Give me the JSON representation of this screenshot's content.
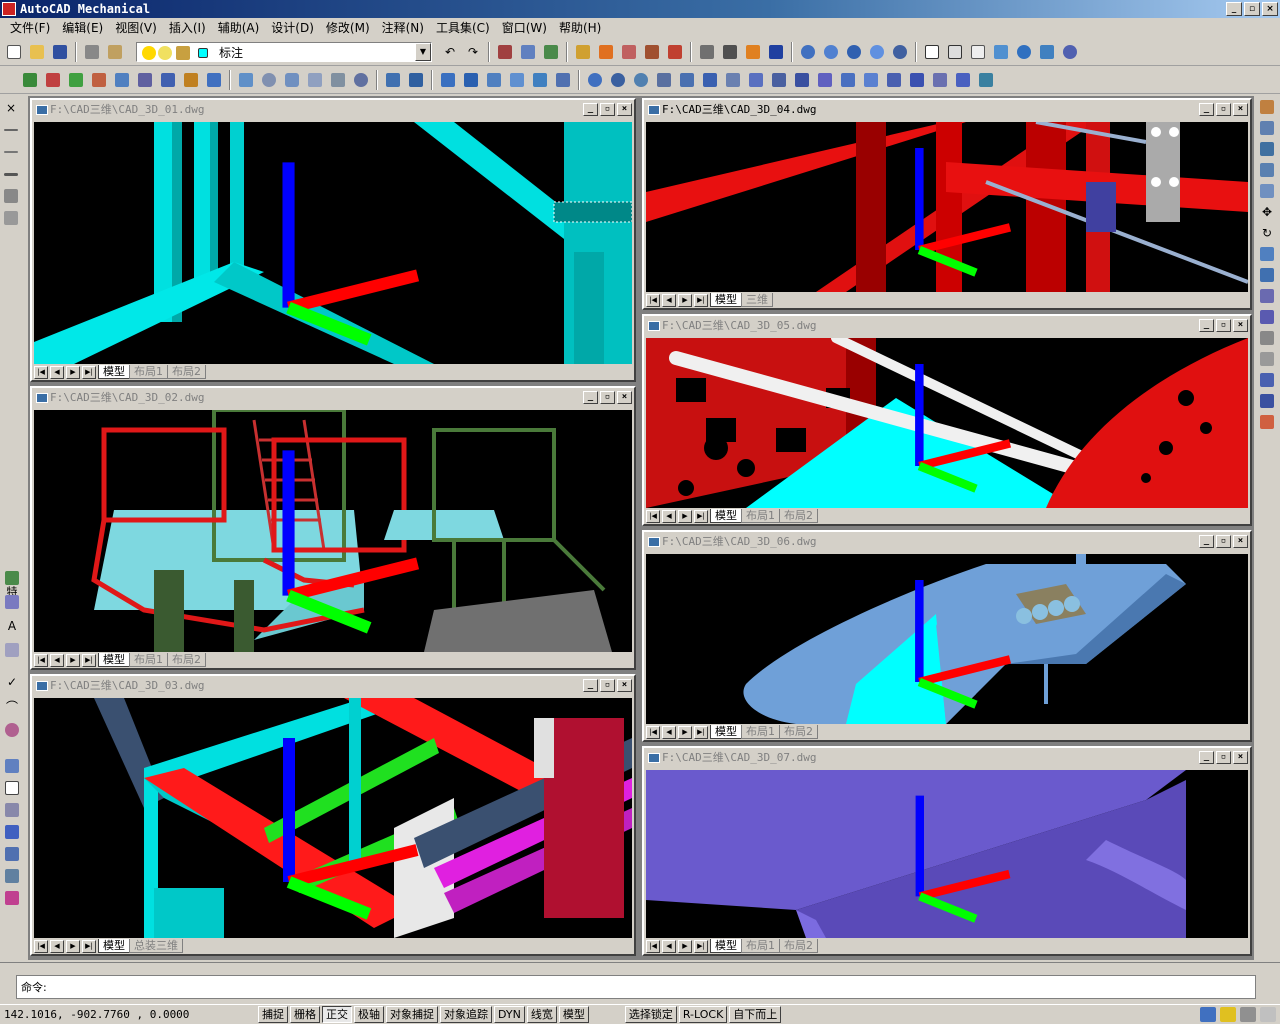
{
  "app": {
    "title": "AutoCAD Mechanical"
  },
  "menu": [
    "文件(F)",
    "编辑(E)",
    "视图(V)",
    "插入(I)",
    "辅助(A)",
    "设计(D)",
    "修改(M)",
    "注释(N)",
    "工具集(C)",
    "窗口(W)",
    "帮助(H)"
  ],
  "layer": {
    "current": "标注"
  },
  "left_toolbar": {
    "label": "特性"
  },
  "drawings": [
    {
      "title": "F:\\CAD三维\\CAD_3D_01.dwg",
      "tabs": [
        "模型",
        "布局1",
        "布局2"
      ],
      "active_tab": 0
    },
    {
      "title": "F:\\CAD三维\\CAD_3D_02.dwg",
      "tabs": [
        "模型",
        "布局1",
        "布局2"
      ],
      "active_tab": 0
    },
    {
      "title": "F:\\CAD三维\\CAD_3D_03.dwg",
      "tabs": [
        "模型",
        "总装三维"
      ],
      "active_tab": 0
    },
    {
      "title": "F:\\CAD三维\\CAD_3D_04.dwg",
      "tabs": [
        "模型",
        "三维"
      ],
      "active_tab": 0
    },
    {
      "title": "F:\\CAD三维\\CAD_3D_05.dwg",
      "tabs": [
        "模型",
        "布局1",
        "布局2"
      ],
      "active_tab": 0
    },
    {
      "title": "F:\\CAD三维\\CAD_3D_06.dwg",
      "tabs": [
        "模型",
        "布局1",
        "布局2"
      ],
      "active_tab": 0
    },
    {
      "title": "F:\\CAD三维\\CAD_3D_07.dwg",
      "tabs": [
        "模型",
        "布局1",
        "布局2"
      ],
      "active_tab": 0
    }
  ],
  "command": {
    "prompt": "命令:"
  },
  "status": {
    "coords": "142.1016,  -902.7760 ,  0.0000",
    "buttons": [
      "捕捉",
      "栅格",
      "正交",
      "极轴",
      "对象捕捉",
      "对象追踪",
      "DYN",
      "线宽",
      "模型"
    ],
    "active": [
      "正交"
    ],
    "buttons2": [
      "选择锁定",
      "R-LOCK",
      "自下而上"
    ]
  },
  "colors": {
    "cyan": "#00ffff",
    "red": "#ff0000",
    "green": "#4a7a3a",
    "blue": "#6a5acd",
    "steel": "#6fa0d8"
  }
}
